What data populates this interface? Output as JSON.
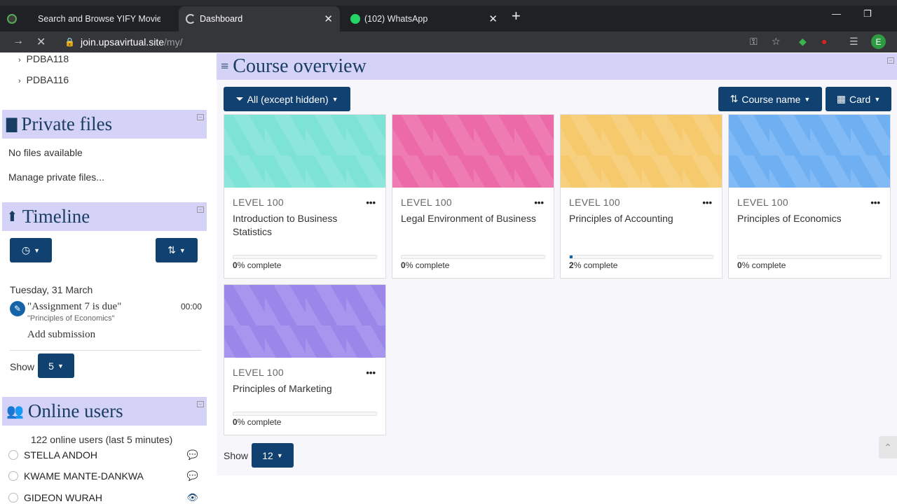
{
  "browser": {
    "tabs": [
      {
        "title": "Search and Browse YIFY Movies",
        "active": false
      },
      {
        "title": "Dashboard",
        "active": true
      },
      {
        "title": "(102) WhatsApp",
        "active": false
      }
    ],
    "url_domain": "join.upsavirtual.site",
    "url_path": "/my/",
    "profile_initial": "E"
  },
  "nav_items": [
    "PDBA118",
    "PDBA116"
  ],
  "private_files": {
    "title": "Private files",
    "empty_text": "No files available",
    "manage_link": "Manage private files..."
  },
  "timeline": {
    "title": "Timeline",
    "date": "Tuesday, 31 March",
    "event": {
      "name": "\"Assignment 7 is due\"",
      "course": "\"Principles of Economics\"",
      "time": "00:00",
      "action": "Add submission"
    },
    "show_label": "Show",
    "show_value": "5"
  },
  "online_users": {
    "title": "Online users",
    "summary": "122 online users (last 5 minutes)",
    "users": [
      {
        "name": "STELLA ANDOH"
      },
      {
        "name": "KWAME MANTE-DANKWA"
      },
      {
        "name": "GIDEON WURAH"
      }
    ]
  },
  "course_overview": {
    "title": "Course overview",
    "filter_label": "All (except hidden)",
    "sort_label": "Course name",
    "view_label": "Card",
    "show_label": "Show",
    "show_value": "12",
    "courses": [
      {
        "level": "LEVEL 100",
        "name": "Introduction to Business Statistics",
        "progress": 0,
        "progress_num": "0",
        "progress_suffix": "% complete",
        "color": "#7de3d6"
      },
      {
        "level": "LEVEL 100",
        "name": "Legal Environment of Business",
        "progress": 0,
        "progress_num": "0",
        "progress_suffix": "% complete",
        "color": "#ec6aa7"
      },
      {
        "level": "LEVEL 100",
        "name": "Principles of Accounting",
        "progress": 2,
        "progress_num": "2",
        "progress_suffix": "% complete",
        "color": "#f5c96c"
      },
      {
        "level": "LEVEL 100",
        "name": "Principles of Economics",
        "progress": 0,
        "progress_num": "0",
        "progress_suffix": "% complete",
        "color": "#6fb0f2"
      },
      {
        "level": "LEVEL 100",
        "name": "Principles of Marketing",
        "progress": 0,
        "progress_num": "0",
        "progress_suffix": "% complete",
        "color": "#9b87ea"
      }
    ]
  }
}
